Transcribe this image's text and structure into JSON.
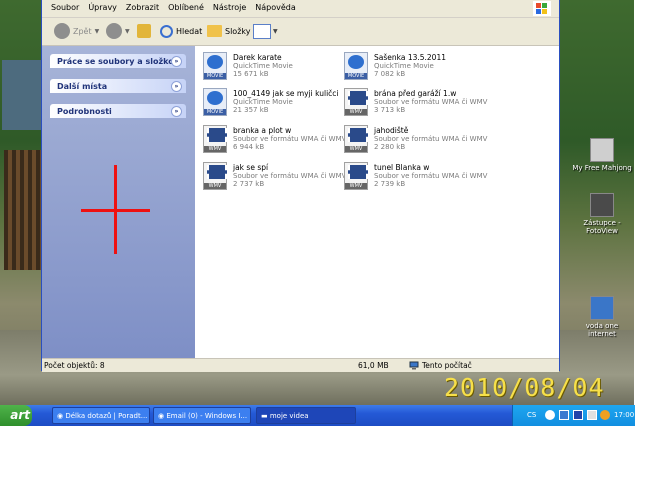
{
  "menu": [
    "Soubor",
    "Úpravy",
    "Zobrazit",
    "Oblíbené",
    "Nástroje",
    "Nápověda"
  ],
  "toolbar": {
    "back": "Zpět",
    "search": "Hledat",
    "folders": "Složky"
  },
  "tasks": [
    {
      "label": "Práce se soubory a složkou"
    },
    {
      "label": "Další místa"
    },
    {
      "label": "Podrobnosti"
    }
  ],
  "files": [
    {
      "name": "Darek karate",
      "type": "QuickTime Movie",
      "size": "15 671 kB",
      "icon": "quicktime-icon"
    },
    {
      "name": "Sašenka 13.5.2011",
      "type": "QuickTime Movie",
      "size": "7 082 kB",
      "icon": "quicktime-icon"
    },
    {
      "name": "100_4149 jak se myji kuličci",
      "type": "QuickTime Movie",
      "size": "21 357 kB",
      "icon": "quicktime-icon"
    },
    {
      "name": "brána před garáží 1.w",
      "type": "Soubor ve formátu WMA či WMV",
      "size": "3 713 kB",
      "icon": "wmv-icon"
    },
    {
      "name": "branka a plot w",
      "type": "Soubor ve formátu WMA či WMV",
      "size": "6 944 kB",
      "icon": "wmv-icon"
    },
    {
      "name": "jahodiště",
      "type": "Soubor ve formátu WMA či WMV",
      "size": "2 280 kB",
      "icon": "wmv-icon"
    },
    {
      "name": "jak se spí",
      "type": "Soubor ve formátu WMA či WMV",
      "size": "2 737 kB",
      "icon": "wmv-icon"
    },
    {
      "name": "tunel Blanka w",
      "type": "Soubor ve formátu WMA či WMV",
      "size": "2 739 kB",
      "icon": "wmv-icon"
    }
  ],
  "status": {
    "count": "Počet objektů: 8",
    "size": "61,0 MB",
    "location": "Tento počítač"
  },
  "desktop_icons": [
    {
      "label": "My Free Mahjong"
    },
    {
      "label": "Zástupce - FotoView"
    },
    {
      "label": "voda one internet"
    }
  ],
  "date_stamp": "2010/08/04",
  "taskbar": {
    "start": "art",
    "tasks": [
      "Délka dotazů | Poradt...",
      "Email (0) - Windows I...",
      "moje videa"
    ],
    "tray_lang": "CS",
    "clock": "17:00"
  },
  "colors": {
    "accent": "#2459d6",
    "annotation": "#ee1111",
    "stamp": "#f7e04a"
  }
}
